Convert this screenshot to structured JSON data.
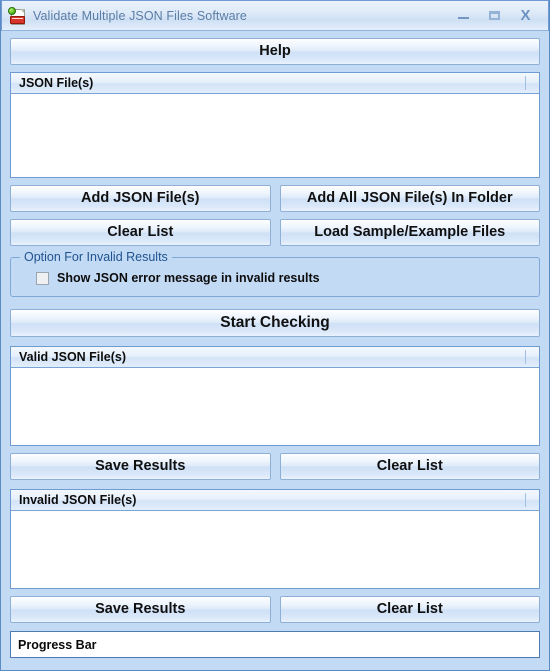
{
  "window": {
    "title": "Validate Multiple JSON Files Software",
    "icon": "json-document-icon",
    "controls": {
      "minimize": "minimize-icon",
      "maximize": "maximize-icon",
      "close": "X"
    }
  },
  "colors": {
    "window_background": "#c3daf5",
    "window_border": "#5b8bc4",
    "title_text": "#5a7da6",
    "button_border": "#8fb0d6",
    "listbox_border": "#6e9bd0",
    "group_title_text": "#21548f",
    "text": "#101010"
  },
  "toolbar": {
    "help_label": "Help"
  },
  "input_section": {
    "list_header": "JSON File(s)",
    "list_items": [],
    "buttons": {
      "add_files": "Add JSON File(s)",
      "add_folder": "Add All JSON File(s) In Folder",
      "clear_list": "Clear List",
      "load_samples": "Load Sample/Example Files"
    }
  },
  "options_group": {
    "title": "Option For Invalid Results",
    "checkbox": {
      "label": "Show JSON error message in invalid results",
      "checked": false
    }
  },
  "action": {
    "start_checking_label": "Start Checking"
  },
  "valid_section": {
    "list_header": "Valid JSON File(s)",
    "list_items": [],
    "buttons": {
      "save_results": "Save Results",
      "clear_list": "Clear List"
    }
  },
  "invalid_section": {
    "list_header": "Invalid JSON File(s)",
    "list_items": [],
    "buttons": {
      "save_results": "Save Results",
      "clear_list": "Clear List"
    }
  },
  "status": {
    "progress_bar_label": "Progress Bar"
  }
}
